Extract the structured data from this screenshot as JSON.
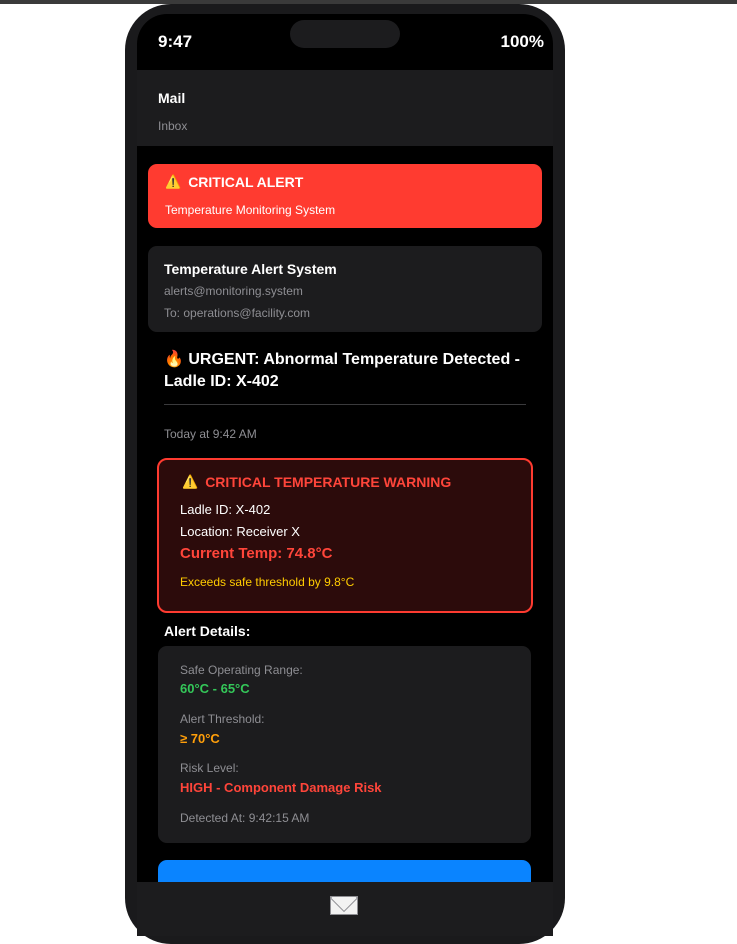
{
  "status_bar": {
    "time": "9:47",
    "battery": "100%"
  },
  "mail_header": {
    "title": "Mail",
    "subtitle": "Inbox"
  },
  "critical_banner": {
    "icon": "warning-icon",
    "title": "CRITICAL ALERT",
    "subtitle": "Temperature Monitoring System"
  },
  "sender": {
    "name": "Temperature Alert System",
    "email": "alerts@monitoring.system",
    "to": "To: operations@facility.com"
  },
  "subject": {
    "icon": "🔥",
    "text": "URGENT: Abnormal Temperature Detected - Ladle ID: X-402"
  },
  "date": "Today at 9:42 AM",
  "warning": {
    "icon": "warning-icon",
    "title": "CRITICAL TEMPERATURE WARNING",
    "ladle": "Ladle ID: X-402",
    "location": "Location: Receiver X",
    "current_temp": "Current Temp: 74.8°C",
    "exceeds": "Exceeds safe threshold by 9.8°C"
  },
  "details": {
    "heading": "Alert Details:",
    "safe_range_label": "Safe Operating Range:",
    "safe_range_value": "60°C - 65°C",
    "threshold_label": "Alert Threshold:",
    "threshold_value": "≥ 70°C",
    "risk_label": "Risk Level:",
    "risk_value": "HIGH - Component Damage Risk",
    "detected_at": "Detected At: 9:42:15 AM"
  },
  "colors": {
    "critical": "#ff3b30",
    "safe": "#34c759",
    "threshold": "#ff9f0a",
    "accent": "#0a84ff"
  },
  "bottom_bar": {
    "icon": "envelope-icon"
  }
}
